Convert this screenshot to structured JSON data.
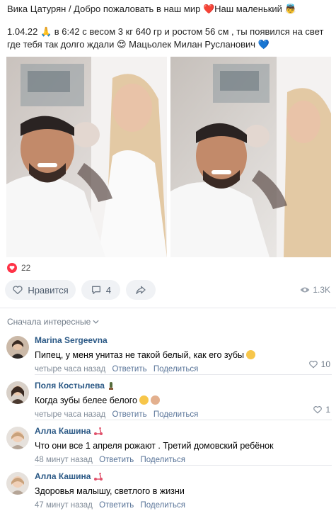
{
  "post": {
    "header": "Вика Цатурян / Добро пожаловать в наш мир ❤️Наш маленький 👼",
    "text": "1.04.22 🙏 в 6:42 с весом 3 кг 640 гр и ростом 56 см , ты появился на свет где тебя так долго ждали 😍 Мацьолек Милан Русланович 💙",
    "likes_count": "22",
    "like_label": "Нравится",
    "comments_count": "4",
    "views": "1.3K"
  },
  "comments_section": {
    "sort_label": "Сначала интересные"
  },
  "comments": [
    {
      "author": "Marina Sergeevna",
      "text": "Пипец, у меня унитаз не такой белый, как его зубы",
      "time": "четыре часа назад",
      "reply": "Ответить",
      "share": "Поделиться",
      "likes": "10"
    },
    {
      "author": "Поля Костылева",
      "text": "Когда зубы белее белого",
      "time": "четыре часа назад",
      "reply": "Ответить",
      "share": "Поделиться",
      "likes": "1"
    },
    {
      "author": "Алла Кашина",
      "text": "Что они все 1 апреля рожают . Третий домовский ребёнок",
      "time": "48 минут назад",
      "reply": "Ответить",
      "share": "Поделиться",
      "likes": ""
    },
    {
      "author": "Алла Кашина",
      "text": "Здоровья малышу, светлого в жизни",
      "time": "47 минут назад",
      "reply": "Ответить",
      "share": "Поделиться",
      "likes": ""
    }
  ],
  "colors": {
    "accent": "#2a5885",
    "like_red": "#ff3347",
    "button_bg": "#f0f2f5",
    "meta_gray": "#818c99"
  },
  "icons": {
    "like": "heart-icon",
    "comment": "comment-bubble-icon",
    "share": "share-arrow-icon",
    "views": "eye-icon",
    "sort": "chevron-down-icon"
  }
}
